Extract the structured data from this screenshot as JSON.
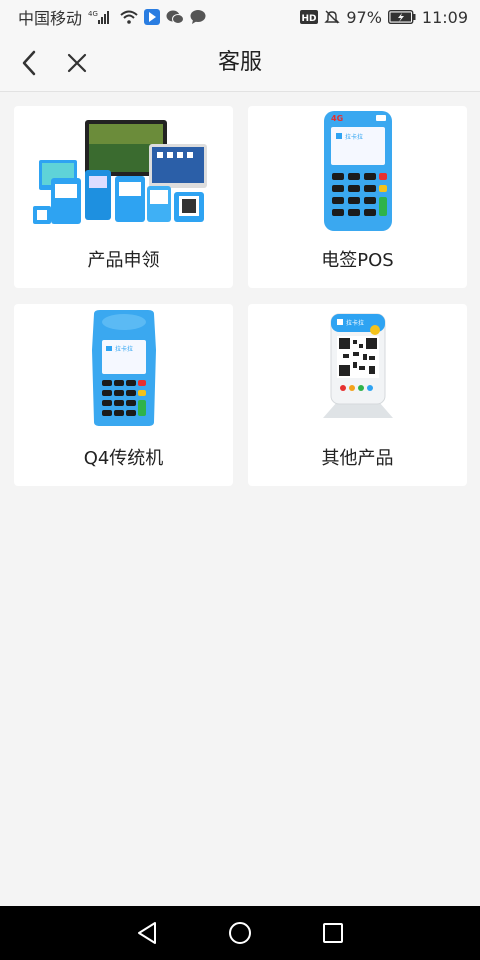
{
  "status_bar": {
    "carrier": "中国移动",
    "network": "4G",
    "battery_percent": "97%",
    "time": "11:09",
    "hd_label": "HD"
  },
  "nav": {
    "title": "客服",
    "back_icon": "chevron-left-icon",
    "close_icon": "close-icon"
  },
  "products": [
    {
      "label": "产品申领",
      "image": "product-bundle-image"
    },
    {
      "label": "电签POS",
      "image": "epos-terminal-image",
      "badge": "4G",
      "brand": "拉卡拉"
    },
    {
      "label": "Q4传统机",
      "image": "q4-terminal-image",
      "brand": "拉卡拉"
    },
    {
      "label": "其他产品",
      "image": "qr-stand-image",
      "brand": "拉卡拉"
    }
  ],
  "colors": {
    "accent_blue": "#2ea3f2",
    "background": "#f4f4f4",
    "card": "#ffffff"
  }
}
